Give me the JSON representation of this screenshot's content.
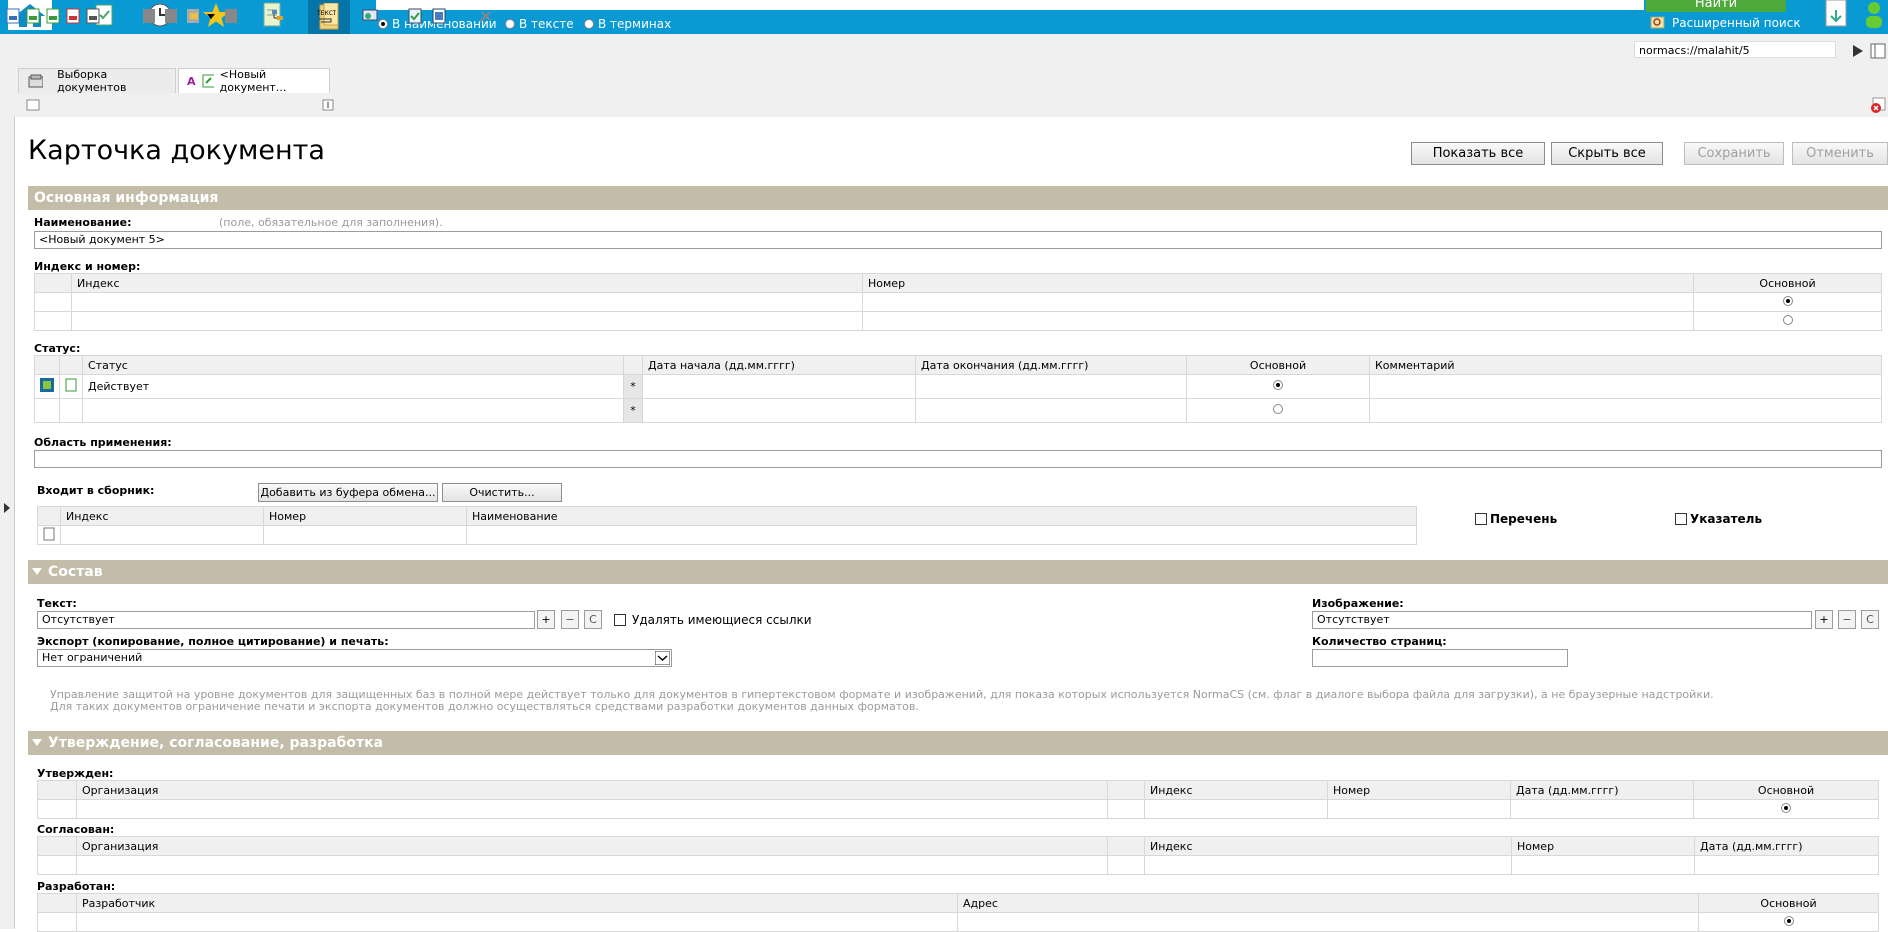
{
  "search": {
    "mode_options": [
      "В наименовании",
      "В тексте",
      "В терминах"
    ],
    "selected_mode": 0,
    "find_label": "Найти",
    "advanced_label": "Расширенный поиск"
  },
  "address": {
    "value": "normacs://malahit/5"
  },
  "tabs": [
    {
      "label": "Выборка документов"
    },
    {
      "label": "<Новый документ..."
    }
  ],
  "page": {
    "title": "Карточка документа",
    "buttons": {
      "show_all": "Показать все",
      "hide_all": "Скрыть все",
      "save": "Сохранить",
      "cancel": "Отменить"
    }
  },
  "main_info": {
    "section_title": "Основная информация",
    "name_label": "Наименование:",
    "name_hint": "(поле, обязательное для заполнения).",
    "name_value": "<Новый документ      5>",
    "index_label": "Индекс и номер:",
    "index_cols": [
      "Индекс",
      "Номер",
      "Основной"
    ],
    "status_label": "Статус:",
    "status_cols": [
      "Статус",
      "Дата начала (дд.мм.гггг)",
      "Дата окончания (дд.мм.гггг)",
      "Основной",
      "Комментарий"
    ],
    "status_rows": [
      {
        "status": "Действует",
        "star": "*"
      },
      {
        "status": "",
        "star": "*"
      }
    ],
    "scope_label": "Область применения:",
    "collection_label": "Входит в сборник:",
    "add_clipboard": "Добавить из буфера обмена...",
    "clear": "Очистить...",
    "collection_cols": [
      "Индекс",
      "Номер",
      "Наименование"
    ],
    "list_label": "Перечень",
    "pointer_label": "Указатель"
  },
  "composition": {
    "section_title": "Состав",
    "text_label": "Текст:",
    "text_value": "Отсутствует",
    "plus": "+",
    "minus": "−",
    "c": "C",
    "delete_links": "Удалять имеющиеся ссылки",
    "image_label": "Изображение:",
    "image_value": "Отсутствует",
    "export_label": "Экспорт (копирование, полное цитирование) и печать:",
    "export_value": "Нет ограничений",
    "pages_label": "Количество страниц:",
    "note_line1": "Управление защитой на уровне документов для защищенных баз в полной мере действует только для документов в гипертекстовом формате и изображений, для показа которых используется NormaCS (см. флаг в диалоге выбора файла для загрузки), а не браузерные надстройки.",
    "note_line2": "Для таких документов ограничение печати и экспорта документов должно осуществляться средствами разработки документов данных форматов."
  },
  "approval": {
    "section_title": "Утверждение, согласование, разработка",
    "approved_label": "Утвержден:",
    "approved_cols": [
      "Организация",
      "Индекс",
      "Номер",
      "Дата (дд.мм.гггг)",
      "Основной"
    ],
    "agreed_label": "Согласован:",
    "agreed_cols": [
      "Организация",
      "Индекс",
      "Номер",
      "Дата (дд.мм.гггг)"
    ],
    "developed_label": "Разработан:",
    "developed_cols": [
      "Разработчик",
      "Адрес",
      "Основной"
    ]
  }
}
